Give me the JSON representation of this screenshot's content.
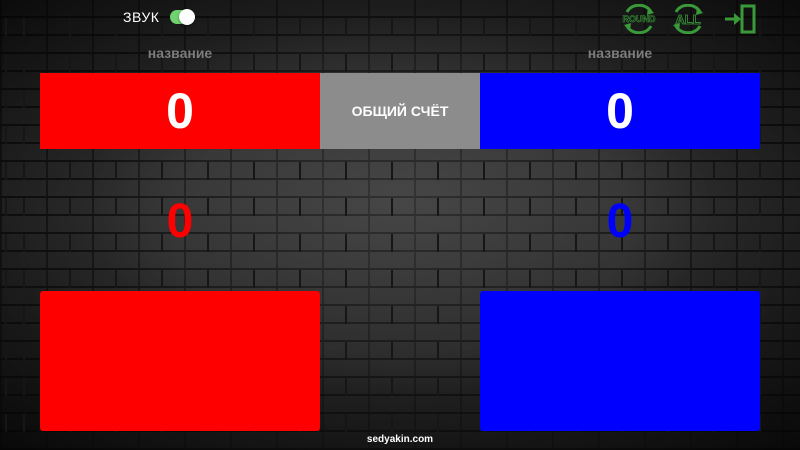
{
  "header": {
    "sound_label": "ЗВУК",
    "sound_enabled": true,
    "icons": {
      "round": {
        "name": "round-reset-icon",
        "text": "ROUND",
        "color": "#3a9a3a"
      },
      "all": {
        "name": "all-reset-icon",
        "text": "ALL",
        "color": "#3a9a3a"
      },
      "exit": {
        "name": "exit-icon",
        "color": "#3a9a3a"
      }
    }
  },
  "left_team": {
    "name": "название",
    "total_score": "0",
    "round_score": "0",
    "color": "#ff0000"
  },
  "right_team": {
    "name": "название",
    "total_score": "0",
    "round_score": "0",
    "color": "#0000ff"
  },
  "center": {
    "total_label": "ОБЩИЙ СЧЁТ"
  },
  "footer": {
    "site": "sedyakin.com"
  }
}
